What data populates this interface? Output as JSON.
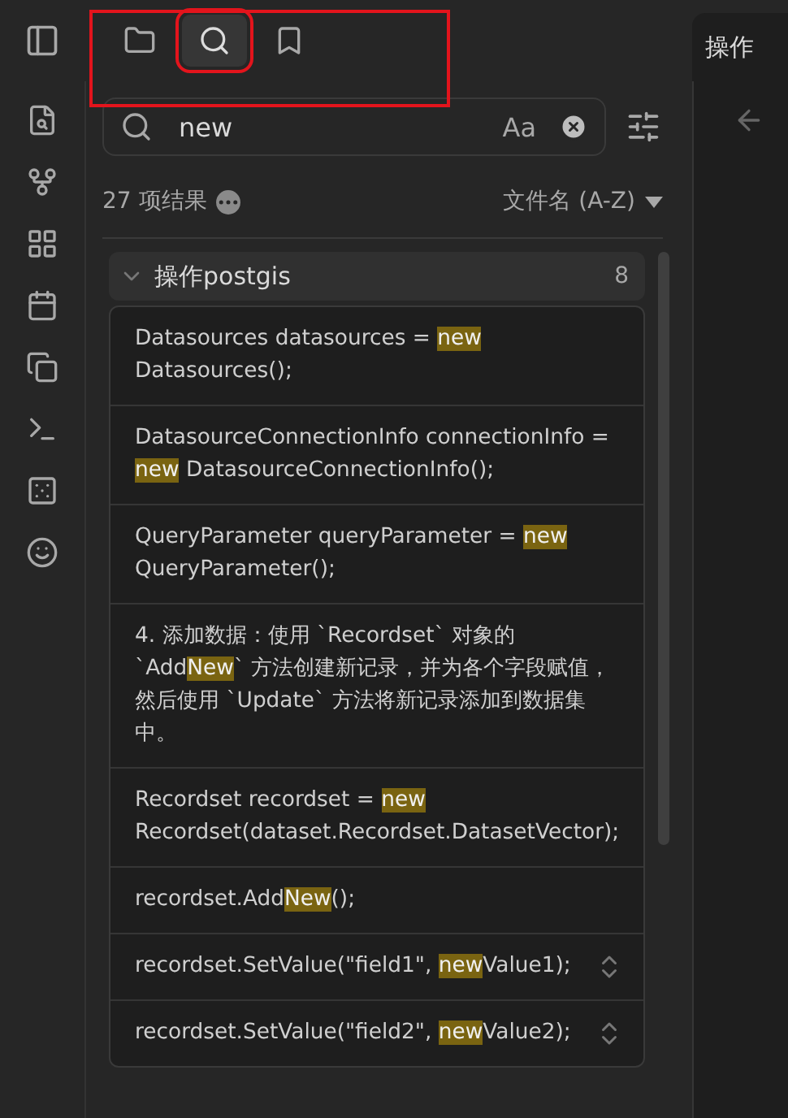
{
  "tab_strip": {
    "annotated": true,
    "tabs": [
      {
        "selected": false,
        "annotated": false
      },
      {
        "selected": true,
        "annotated": true
      },
      {
        "selected": false,
        "annotated": false
      }
    ]
  },
  "search": {
    "value": "new",
    "match_case": "Aa"
  },
  "summary": {
    "count": "27 项结果",
    "sort": "文件名 (A-Z)"
  },
  "group": {
    "title": "操作postgis",
    "count": "8",
    "expanded": true,
    "matches": [
      {
        "text": "Datasources datasources = **new** Datasources();",
        "expandable": false
      },
      {
        "text": "DatasourceConnectionInfo connectionInfo = **new** DatasourceConnectionInfo();",
        "expandable": false
      },
      {
        "text": "QueryParameter queryParameter = **new** QueryParameter();",
        "expandable": false
      },
      {
        "text": "4. 添加数据：使用 `Recordset` 对象的 `Add**New**` 方法创建新记录，并为各个字段赋值，然后使用 `Update` 方法将新记录添加到数据集中。",
        "expandable": false
      },
      {
        "text": "Recordset recordset = **new** Recordset(dataset.Recordset.DatasetVector);",
        "expandable": false
      },
      {
        "text": "recordset.Add**New**();",
        "expandable": false
      },
      {
        "text": "recordset.SetValue(\"field1\", **new**Value1);",
        "expandable": true
      },
      {
        "text": "recordset.SetValue(\"field2\", **new**Value2);",
        "expandable": true
      }
    ]
  },
  "editor_tab": {
    "title": "操作"
  }
}
